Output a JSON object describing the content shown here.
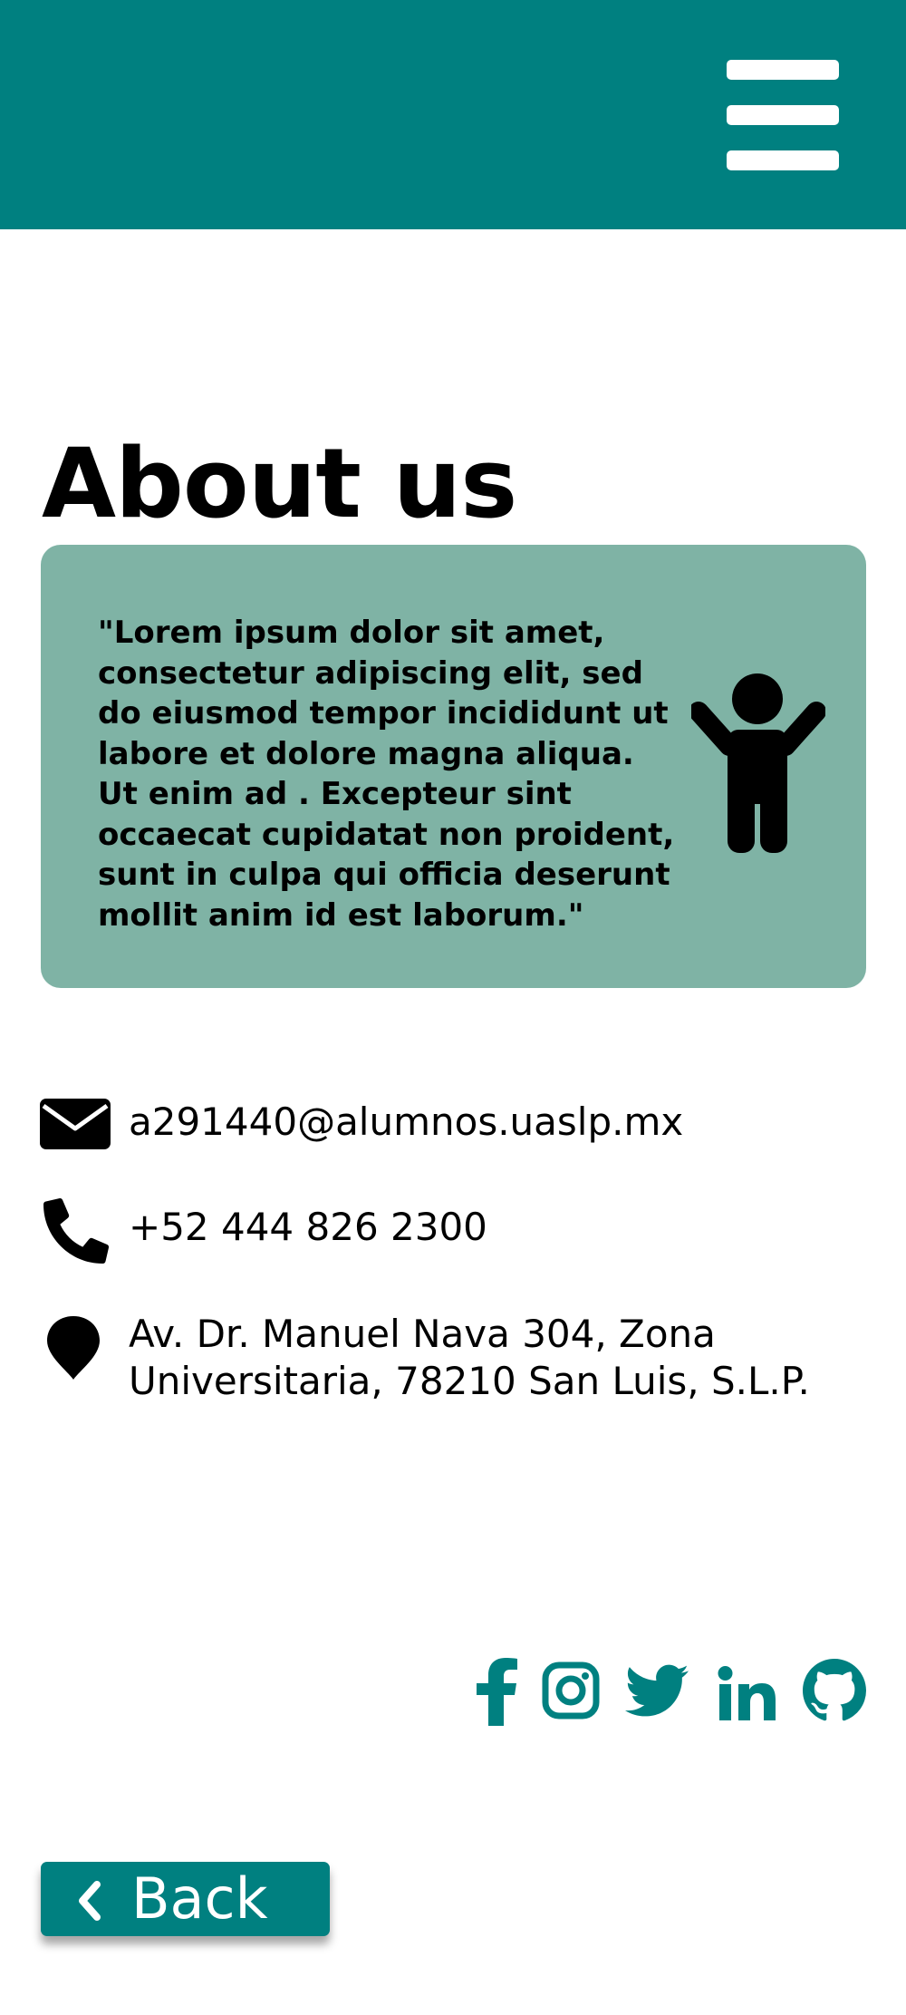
{
  "theme": {
    "accent": "#008080",
    "card_background": "#7fb3a5",
    "text": "#000000"
  },
  "header": {
    "menu_icon": "hamburger-menu-icon"
  },
  "main": {
    "title": "About us",
    "quote": {
      "text": "\"Lorem ipsum dolor sit amet, consectetur adipiscing elit, sed do eiusmod tempor incididunt ut labore et dolore magna aliqua. Ut enim ad . Excepteur sint occaecat cupidatat non proident, sunt in culpa qui officia deserunt mollit anim id est laborum.\"",
      "icon": "child-person-icon"
    },
    "contact": {
      "email": {
        "icon": "envelope-icon",
        "text": "a291440@alumnos.uaslp.mx"
      },
      "phone": {
        "icon": "phone-icon",
        "text": "+52 444 826 2300"
      },
      "address": {
        "icon": "map-pin-icon",
        "line1": "Av. Dr. Manuel Nava 304, Zona",
        "line2": "Universitaria, 78210 San Luis, S.L.P."
      }
    }
  },
  "social": [
    "facebook-icon",
    "instagram-icon",
    "twitter-icon",
    "linkedin-icon",
    "github-icon"
  ],
  "back_button": {
    "label": "Back",
    "icon": "chevron-left-icon"
  }
}
